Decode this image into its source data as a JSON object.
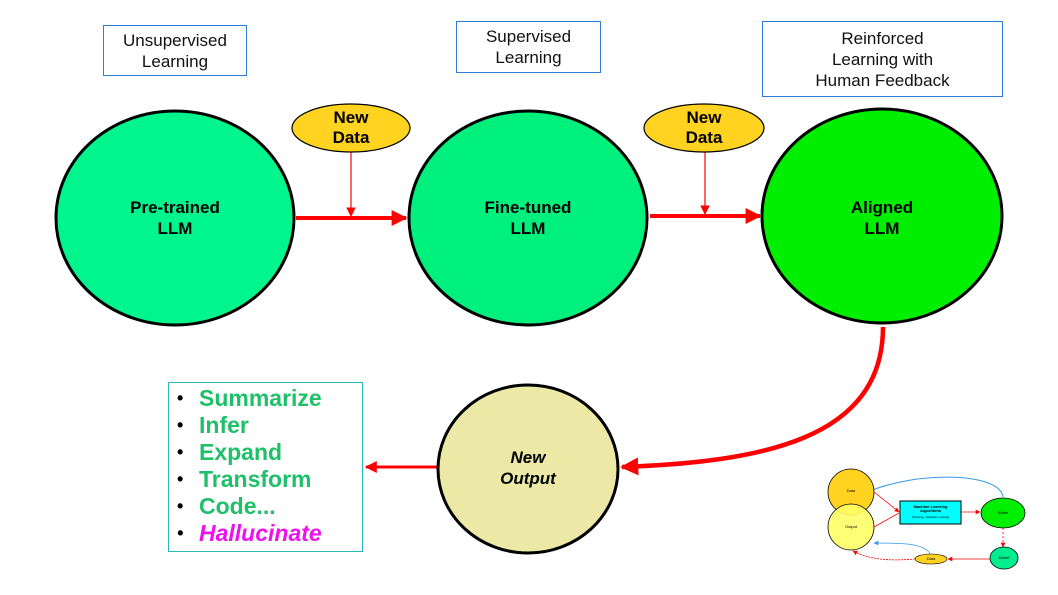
{
  "stages": [
    {
      "label": "Unsupervised\nLearning"
    },
    {
      "label": "Supervised\nLearning"
    },
    {
      "label": "Reinforced\nLearning with\nHuman Feedback"
    }
  ],
  "nodes": {
    "pretrained": {
      "label": "Pre-trained\nLLM",
      "fill": "#00f58c"
    },
    "finetuned": {
      "label": "Fine-tuned\nLLM",
      "fill": "#00f07e"
    },
    "aligned": {
      "label": "Aligned\nLLM",
      "fill": "#00ee00"
    },
    "new_output": {
      "label": "New\nOutput",
      "fill": "#ebe9a5"
    }
  },
  "data_inputs": [
    {
      "label": "New\nData",
      "fill": "#ffd320"
    },
    {
      "label": "New\nData",
      "fill": "#ffd320"
    }
  ],
  "tasks": {
    "items": [
      "Summarize",
      "Infer",
      "Expand",
      "Transform",
      "Code...",
      "Hallucinate"
    ],
    "bullet": "•",
    "color": "#1fc06a",
    "highlight_color": "#ee11ee"
  },
  "arrow_color": "#ff0000",
  "thumbnail": {
    "data_top": "Data",
    "output": "Output",
    "algorithms": "Machine Learning\nAlgorithms",
    "algorithms_sub": "(Training, validation, testing)",
    "rules": "Rules",
    "model": "Model",
    "data_bottom": "Data"
  }
}
